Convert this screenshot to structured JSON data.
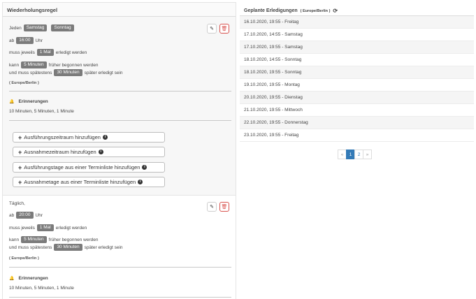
{
  "left_panel": {
    "title": "Wiederholungsregel",
    "rule1": {
      "jeden": "Jeden",
      "days": [
        "Samstag",
        "Sonntag"
      ],
      "ab": "ab",
      "time": "16:00",
      "uhr": "Uhr",
      "muss_jeweils": "muss jeweils",
      "count": "1 Mal",
      "erledigt": "erledigt werden",
      "kann": "kann",
      "early": "5 Minuten",
      "frueher": "früher begonnen werden",
      "und_muss": "und muss spätestens",
      "late": "30 Minuten",
      "spaeter": "später erledigt sein",
      "timezone": "( Europe/Berlin )",
      "reminders_title": "Erinnerungen",
      "reminders": "10 Minuten, 5 Minuten, 1 Minute"
    },
    "add_buttons": [
      "Ausführungszeitraum hinzufügen",
      "Ausnahmezeitraum hinzufügen",
      "Ausführungstage aus einer Terminliste hinzufügen",
      "Ausnahmetage aus einer Terminliste hinzufügen"
    ],
    "rule2": {
      "daily": "Täglich,",
      "ab": "ab",
      "time": "20:00",
      "uhr": "Uhr",
      "muss_jeweils": "muss jeweils",
      "count": "1 Mal",
      "erledigt": "erledigt werden",
      "kann": "kann",
      "early": "5 Minuten",
      "frueher": "früher begonnen werden",
      "und_muss": "und muss spätestens",
      "late": "30 Minuten",
      "spaeter": "später erledigt sein",
      "timezone": "( Europe/Berlin )",
      "reminders_title": "Erinnerungen",
      "reminders": "10 Minuten, 5 Minuten, 1 Minute"
    }
  },
  "right_panel": {
    "title": "Geplante Erledigungen",
    "timezone": "( Europe/Berlin )",
    "rows": [
      "16.10.2020, 19:55 - Freitag",
      "17.10.2020, 14:55 - Samstag",
      "17.10.2020, 19:55 - Samstag",
      "18.10.2020, 14:55 - Sonntag",
      "18.10.2020, 19:55 - Sonntag",
      "19.10.2020, 19:55 - Montag",
      "20.10.2020, 19:55 - Dienstag",
      "21.10.2020, 19:55 - Mittwoch",
      "22.10.2020, 19:55 - Donnerstag",
      "23.10.2020, 19:55 - Freitag"
    ],
    "pagination": {
      "prev": "«",
      "pages": [
        "1",
        "2"
      ],
      "next": "»"
    }
  },
  "icons": {
    "edit": "pencil-icon",
    "delete": "trash-icon",
    "bell": "bell-icon",
    "refresh": "refresh-icon",
    "info": "info-icon"
  },
  "colors": {
    "badge": "#7b7b7b",
    "danger": "#d9534f",
    "accent": "#337ab7"
  }
}
